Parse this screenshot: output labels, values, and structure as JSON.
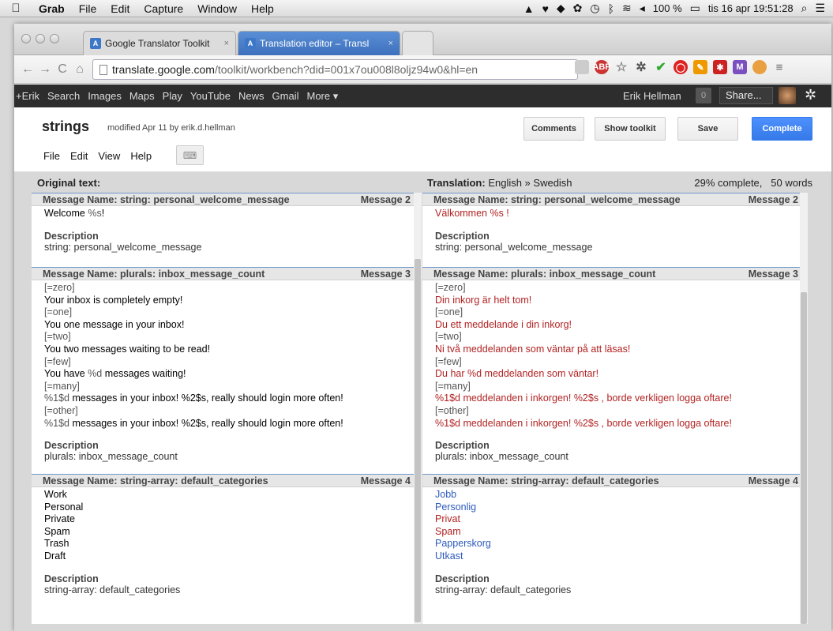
{
  "menubar": {
    "apple": "",
    "items": [
      "Grab",
      "File",
      "Edit",
      "Capture",
      "Window",
      "Help"
    ],
    "battery": "100 %",
    "datetime": "tis 16 apr  19:51:28"
  },
  "browser": {
    "tabs": [
      {
        "title": "Google Translator Toolkit",
        "close": "×"
      },
      {
        "title": "Translation editor – Transl",
        "close": "×"
      }
    ],
    "url_host": "translate.google.com",
    "url_rest": "/toolkit/workbench?did=001x7ou008l8oljz94w0&hl=en"
  },
  "gbar": {
    "links": [
      "+Erik",
      "Search",
      "Images",
      "Maps",
      "Play",
      "YouTube",
      "News",
      "Gmail",
      "More ▾"
    ],
    "user": "Erik Hellman",
    "notifications": "0",
    "share": "Share..."
  },
  "doc": {
    "title": "strings",
    "meta": "modified Apr 11 by erik.d.hellman",
    "menu": [
      "File",
      "Edit",
      "View",
      "Help"
    ],
    "buttons": {
      "comments": "Comments",
      "toolkit": "Show toolkit",
      "save": "Save",
      "complete": "Complete"
    }
  },
  "workbench": {
    "original_label": "Original text:",
    "translation_label": "Translation:",
    "translation_langs": "English » Swedish",
    "progress": "29% complete,",
    "words": "50 words"
  },
  "messages": [
    {
      "name": "Message Name: string: personal_welcome_message",
      "number": "Message 2",
      "original": [
        {
          "t": "Welcome ",
          "p": "%s",
          "r": "!"
        }
      ],
      "translation": [
        {
          "t": "Välkommen %s !",
          "c": "tr"
        }
      ],
      "desc_label": "Description",
      "desc": "string: personal_welcome_message"
    },
    {
      "name": "Message Name: plurals: inbox_message_count",
      "number": "Message 3",
      "original": [
        {
          "t": "",
          "p": "[=zero]",
          "r": ""
        },
        {
          "t": "Your inbox is completely empty!",
          "p": "",
          "r": ""
        },
        {
          "t": "",
          "p": "[=one]",
          "r": ""
        },
        {
          "t": "You one message in your inbox!",
          "p": "",
          "r": ""
        },
        {
          "t": "",
          "p": "[=two]",
          "r": ""
        },
        {
          "t": "You two messages waiting to be read!",
          "p": "",
          "r": ""
        },
        {
          "t": "",
          "p": "[=few]",
          "r": ""
        },
        {
          "t": "You have ",
          "p": "%d",
          "r": " messages waiting!"
        },
        {
          "t": "",
          "p": "[=many]",
          "r": ""
        },
        {
          "t": "",
          "p": "%1$d",
          "r": " messages in your inbox! %2$s, really should login more often!"
        },
        {
          "t": "",
          "p": "[=other]",
          "r": ""
        },
        {
          "t": "",
          "p": "%1$d",
          "r": " messages in your inbox! %2$s, really should login more often!"
        }
      ],
      "translation": [
        {
          "t": "[=zero]",
          "c": "ph"
        },
        {
          "t": "Din inkorg är helt tom!",
          "c": "tr"
        },
        {
          "t": "[=one]",
          "c": "ph"
        },
        {
          "t": "Du ett meddelande i din inkorg!",
          "c": "tr"
        },
        {
          "t": "[=two]",
          "c": "ph"
        },
        {
          "t": "Ni två meddelanden som väntar på att läsas!",
          "c": "tr"
        },
        {
          "t": "[=few]",
          "c": "ph"
        },
        {
          "t": "Du har %d meddelanden som väntar!",
          "c": "tr"
        },
        {
          "t": "[=many]",
          "c": "ph"
        },
        {
          "t": "%1$d meddelanden i inkorgen! %2$s , borde verkligen logga oftare!",
          "c": "tr"
        },
        {
          "t": "[=other]",
          "c": "ph"
        },
        {
          "t": "%1$d meddelanden i inkorgen! %2$s , borde verkligen logga oftare!",
          "c": "tr"
        }
      ],
      "desc_label": "Description",
      "desc": "plurals: inbox_message_count"
    },
    {
      "name": "Message Name: string-array: default_categories",
      "number": "Message 4",
      "original": [
        {
          "t": "Work",
          "p": "",
          "r": ""
        },
        {
          "t": "Personal",
          "p": "",
          "r": ""
        },
        {
          "t": "Private",
          "p": "",
          "r": ""
        },
        {
          "t": "Spam",
          "p": "",
          "r": ""
        },
        {
          "t": "Trash",
          "p": "",
          "r": ""
        },
        {
          "t": "Draft",
          "p": "",
          "r": ""
        }
      ],
      "translation": [
        {
          "t": "Jobb",
          "c": "tr-blue"
        },
        {
          "t": "Personlig",
          "c": "tr-blue"
        },
        {
          "t": "Privat",
          "c": "tr"
        },
        {
          "t": "Spam",
          "c": "tr"
        },
        {
          "t": "Papperskorg",
          "c": "tr-blue"
        },
        {
          "t": "Utkast",
          "c": "tr-blue"
        }
      ],
      "desc_label": "Description",
      "desc": "string-array: default_categories"
    }
  ],
  "colors": {
    "translated_red": "#b22222",
    "translated_blue": "#2d5bbd",
    "complete_button": "#4d90fe",
    "gbar": "#2d2d2d"
  }
}
